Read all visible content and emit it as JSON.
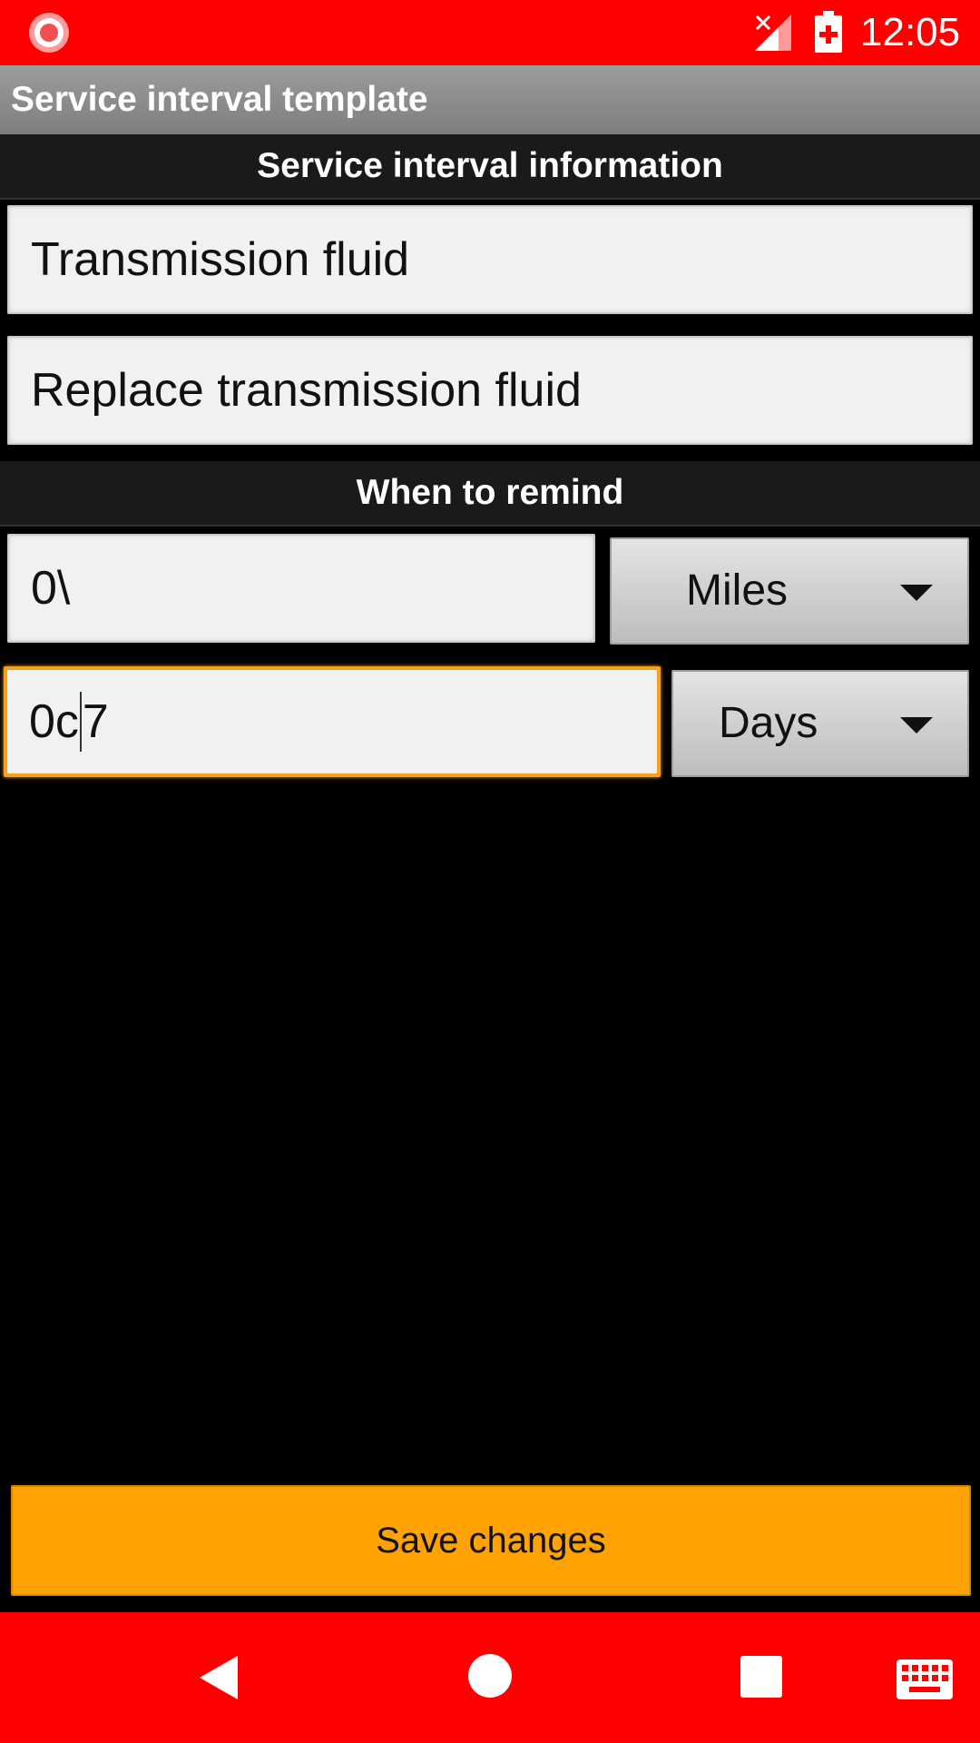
{
  "status_bar": {
    "time": "12:05",
    "icons": [
      "record-icon",
      "signal-off-icon",
      "battery-charging-icon"
    ],
    "color": "#ff0000"
  },
  "action_bar": {
    "title": "Service interval template"
  },
  "sections": {
    "info_header": "Service interval information",
    "remind_header": "When to remind"
  },
  "fields": {
    "name_value": "Transmission fluid",
    "description_value": "Replace transmission fluid",
    "miles_value": "0\\",
    "days_value_before_cursor": "0c",
    "days_value_after_cursor": "7"
  },
  "spinners": {
    "distance_unit": "Miles",
    "time_unit": "Days"
  },
  "buttons": {
    "save_label": "Save changes",
    "save_color": "#ffa305"
  },
  "nav_bar": {
    "icons": [
      "back-icon",
      "home-icon",
      "recents-icon",
      "keyboard-icon"
    ]
  }
}
